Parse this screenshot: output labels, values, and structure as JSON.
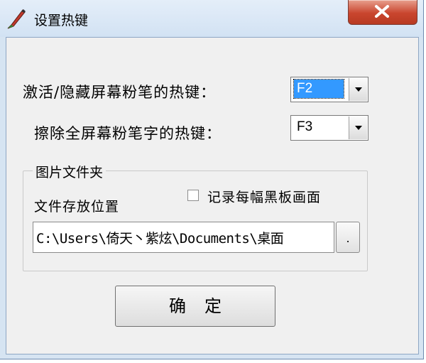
{
  "window": {
    "title": "设置热键"
  },
  "hotkeys": {
    "toggle_label": "激活/隐藏屏幕粉笔的热键：",
    "toggle_value": "F2",
    "erase_label": "擦除全屏幕粉笔字的热键：",
    "erase_value": "F3"
  },
  "picture_folder": {
    "group_title": "图片文件夹",
    "location_label": "文件存放位置",
    "record_checkbox_label": "记录每幅黑板画面",
    "record_checked": false,
    "path_value": "C:\\Users\\倚天丶紫炫\\Documents\\桌面",
    "browse_label": "."
  },
  "actions": {
    "ok_label": "确定"
  },
  "colors": {
    "selection": "#3399ff",
    "close_button": "#c9452e",
    "titlebar": "#d6e4f2"
  },
  "icons": {
    "app": "chalk-icon",
    "close": "close-icon",
    "dropdown": "chevron-down-icon"
  }
}
